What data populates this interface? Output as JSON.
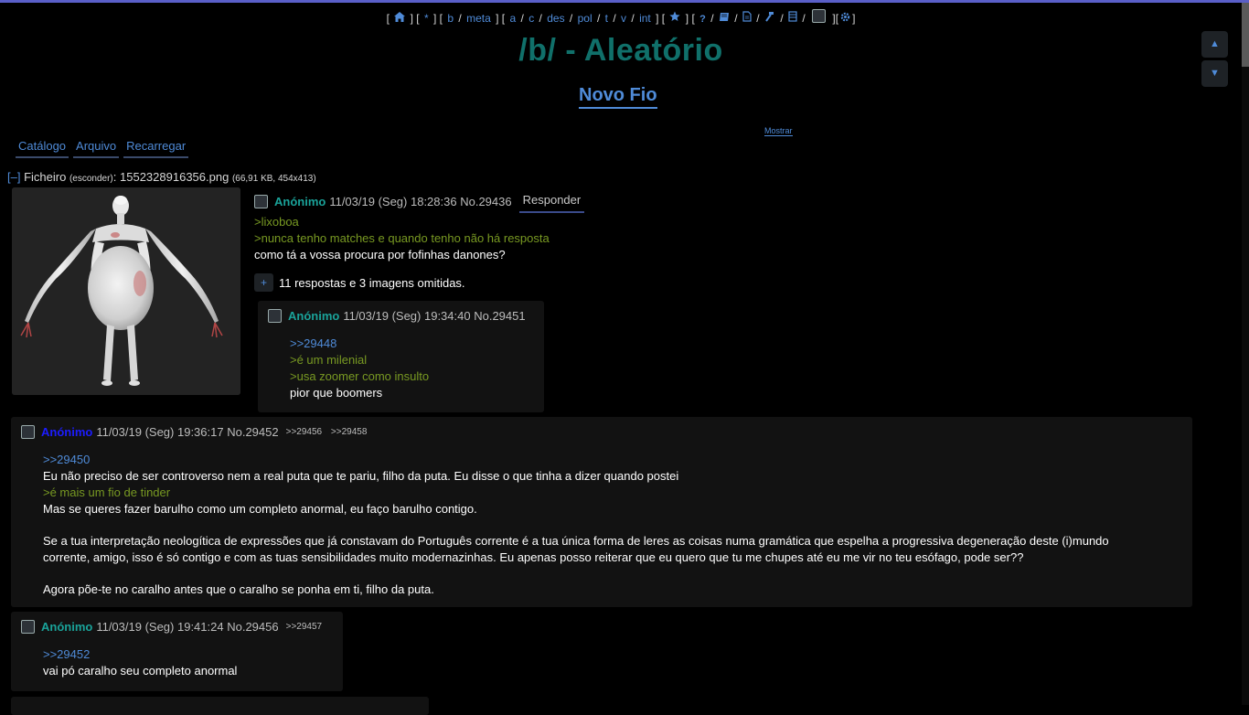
{
  "boardlist": {
    "home_icon": "home-icon",
    "star": "*",
    "boards1": [
      "b",
      "meta"
    ],
    "boards2": [
      "a",
      "c",
      "des",
      "pol",
      "t",
      "v",
      "int"
    ],
    "icons": [
      "star-icon",
      "help-icon",
      "book-icon",
      "document-icon",
      "hammer-icon",
      "archive-icon"
    ],
    "settings_icon": "gear-icon"
  },
  "board": {
    "title": "/b/ - Aleatório",
    "new_thread": "Novo Fio",
    "show_label": "Mostrar"
  },
  "nav": {
    "up": "▲",
    "down": "▼"
  },
  "tabs": [
    "Catálogo",
    "Arquivo",
    "Recarregar"
  ],
  "op": {
    "file": {
      "collapse": "[–]",
      "label": "Ficheiro",
      "hide": "(esconder)",
      "filename": "1552328916356.png",
      "details": "(66,91 KB, 454x413)"
    },
    "name": "Anónimo",
    "date": "11/03/19 (Seg) 18:28:36",
    "no": "No.29436",
    "reply_label": "Responder",
    "lines": [
      {
        "text": ">lixoboa",
        "kind": "green"
      },
      {
        "text": ">nunca tenho matches e quando tenho não há resposta",
        "kind": "green"
      },
      {
        "text": "como tá a vossa procura por fofinhas danones?",
        "kind": "white"
      }
    ],
    "omitted_button": "+",
    "omitted_text": "11 respostas e 3 imagens omitidas."
  },
  "replies": [
    {
      "name": "Anónimo",
      "date": "11/03/19 (Seg) 19:34:40",
      "no": "No.29451",
      "backlinks": [],
      "lines": [
        {
          "text": ">>29448",
          "kind": "link"
        },
        {
          "text": ">é um milenial",
          "kind": "green"
        },
        {
          "text": ">usa zoomer como insulto",
          "kind": "green"
        },
        {
          "text": "pior que boomers",
          "kind": "white"
        }
      ]
    },
    {
      "name": "Anónimo",
      "date": "11/03/19 (Seg) 19:36:17",
      "no": "No.29452",
      "backlinks": [
        ">>29456",
        ">>29458"
      ],
      "lines": [
        {
          "text": ">>29450",
          "kind": "link"
        },
        {
          "text": "Eu não preciso de ser controverso nem a real puta que te pariu, filho da puta. Eu disse o que tinha a dizer quando postei",
          "kind": "white"
        },
        {
          "text": ">é mais um fio de tinder",
          "kind": "green"
        },
        {
          "text": "Mas se queres fazer barulho como um completo anormal, eu faço barulho contigo.",
          "kind": "white"
        },
        {
          "text": "",
          "kind": "gap"
        },
        {
          "text": "Se a tua interpretação neologítica de expressões que já constavam do Português corrente é a tua única forma de leres as coisas numa gramática que espelha a progressiva degeneração deste (i)mundo",
          "kind": "white"
        },
        {
          "text": "corrente, amigo, isso é só contigo e com as tuas sensibilidades muito modernazinhas. Eu apenas posso reiterar que eu quero que tu me chupes até eu me vir no teu esófago, pode ser??",
          "kind": "white"
        },
        {
          "text": "",
          "kind": "gap"
        },
        {
          "text": "Agora põe-te no caralho antes que o caralho se ponha em ti, filho da puta.",
          "kind": "white"
        }
      ]
    },
    {
      "name": "Anónimo",
      "date": "11/03/19 (Seg) 19:41:24",
      "no": "No.29456",
      "backlinks": [
        ">>29457"
      ],
      "lines": [
        {
          "text": ">>29452",
          "kind": "link"
        },
        {
          "text": "vai pó caralho seu completo anormal",
          "kind": "white"
        }
      ]
    }
  ]
}
